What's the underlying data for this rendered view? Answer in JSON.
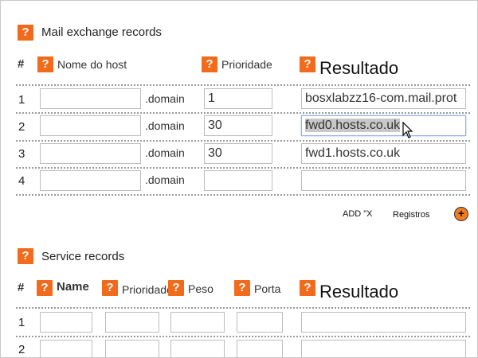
{
  "mx": {
    "title": "Mail exchange records",
    "headers": {
      "hash": "#",
      "host": "Nome do host",
      "priority": "Prioridade",
      "result": "Resultado"
    },
    "domain_suffix": ".domain",
    "rows": [
      {
        "num": "1",
        "host": "",
        "priority": "1",
        "result": "bosxlabzz16-com.mail.prot"
      },
      {
        "num": "2",
        "host": "",
        "priority": "30",
        "result": "fwd0.hosts.co.uk"
      },
      {
        "num": "3",
        "host": "",
        "priority": "30",
        "result": "fwd1.hosts.co.uk"
      },
      {
        "num": "4",
        "host": "",
        "priority": "",
        "result": ""
      }
    ],
    "add_prefix": "ADD \"X",
    "add_suffix": "Registros",
    "add_icon": "plus-icon"
  },
  "srv": {
    "title": "Service records",
    "headers": {
      "hash": "#",
      "name": "Name",
      "priority": "Prioridade",
      "weight": "Peso",
      "port": "Porta",
      "result": "Resultado"
    },
    "rows": [
      {
        "num": "1"
      },
      {
        "num": "2"
      }
    ]
  },
  "help_glyph": "?",
  "colors": {
    "help_icon": "#f26a1b",
    "divider": "#9a9a9a",
    "active_border": "#8fb3e6"
  }
}
